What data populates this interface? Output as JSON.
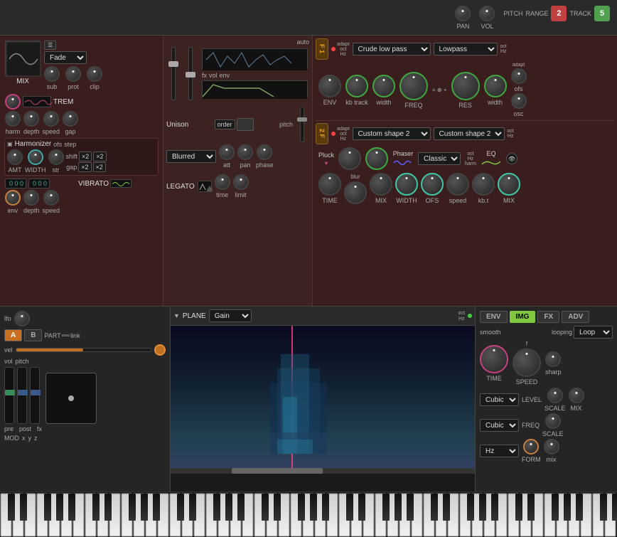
{
  "topbar": {
    "pan_label": "PAN",
    "vol_label": "VOL",
    "pitch_label": "PITCH",
    "range_label": "RANGE",
    "track_label": "TRACK",
    "range_value": "2",
    "track_value": "5"
  },
  "mix": {
    "label": "MIX",
    "fade_label": "Fade",
    "sub_label": "sub",
    "prot_label": "prot",
    "clip_label": "clip",
    "auto_label": "auto",
    "vel_label": "vel",
    "fx_label": "fx",
    "vol_label": "vol",
    "env_label": "env"
  },
  "trem": {
    "label": "TREM",
    "harm_label": "harm",
    "depth_label": "depth",
    "speed_label": "speed",
    "gap_label": "gap"
  },
  "harmonizer": {
    "label": "Harmonizer",
    "ofs_label": "ofs",
    "step_label": "step",
    "shift_label": "shift",
    "gap_label": "gap",
    "amt_label": "AMT",
    "width_label": "WIDTH",
    "str_label": "str",
    "x2_label": "×2",
    "multiplier_label": "×2"
  },
  "unison": {
    "label": "Unison",
    "order_label": "order",
    "pitch_label": "pitch",
    "att_label": "att",
    "pan_label": "pan",
    "phase_label": "phase"
  },
  "blurred": {
    "label": "Blurred"
  },
  "vibrato": {
    "label": "VIBRATO",
    "depth_label": "depth",
    "speed_label": "speed",
    "env_label": "env"
  },
  "legato": {
    "label": "LEGATO",
    "time_label": "time",
    "limit_label": "limit"
  },
  "filter1": {
    "badge": "F\n1",
    "adapt_label": "adapt",
    "oct_label": "oct",
    "hz_label": "Hz",
    "crude_low_pass": "Crude low pass",
    "lowpass": "Lowpass",
    "env_label": "ENV",
    "kb_track_label": "kb\ntrack",
    "width_label": "width",
    "freq_label": "FREQ",
    "res_label": "RES",
    "width2_label": "width",
    "adapt2_label": "adapt",
    "ofs_label": "ofs",
    "osc_label": "osc"
  },
  "filter2": {
    "badge": "2\nF",
    "adapt_label": "adapt",
    "oct_label": "oct",
    "hz_label": "Hz",
    "custom_shape_2_label": "Custom shape 2",
    "custom_shape_2b_label": "Custom shape 2",
    "pluck_label": "Pluck",
    "phaser_label": "Phaser",
    "classic_label": "Classic",
    "eq_label": "EQ",
    "oct2_label": "oct",
    "hz2_label": "Hz",
    "harm_label": "harm",
    "time_label": "TIME",
    "blur_label": "blur",
    "mix_label": "MIX",
    "width_label": "WIDTH",
    "ofs_label": "OFS",
    "speed_label": "speed",
    "kbt_label": "kb.t",
    "mix2_label": "MIX"
  },
  "bottom": {
    "lfo_label": "lfo",
    "a_label": "A",
    "b_label": "B",
    "part_label": "PART",
    "link_label": "link",
    "vel_label": "vel",
    "vol_label": "vol",
    "pitch_label": "pitch",
    "mod_label": "MOD",
    "x_label": "x",
    "y_label": "y",
    "z_label": "z",
    "pre_label": "pre",
    "post_label": "post",
    "fx_label": "fx",
    "plane_label": "PLANE",
    "gain_label": "Gain",
    "oct_label": "oct",
    "hz_label": "Hz"
  },
  "envelope": {
    "env_label": "ENV",
    "img_label": "IMG",
    "fx_label": "FX",
    "adv_label": "ADV",
    "smooth_label": "smooth",
    "looping_label": "looping",
    "loop_label": "Loop",
    "time_label": "TIME",
    "speed_label": "SPEED",
    "sharp_label": "sharp",
    "f_label": "f",
    "cubic1_label": "Cubic",
    "level_label": "LEVEL",
    "scale_label": "SCALE",
    "mix_label": "MIX",
    "freq_label": "FREQ",
    "cubic2_label": "Cubic",
    "scale2_label": "SCALE",
    "form_label": "FORM",
    "mix2_label": "mix",
    "hz_label": "Hz"
  }
}
